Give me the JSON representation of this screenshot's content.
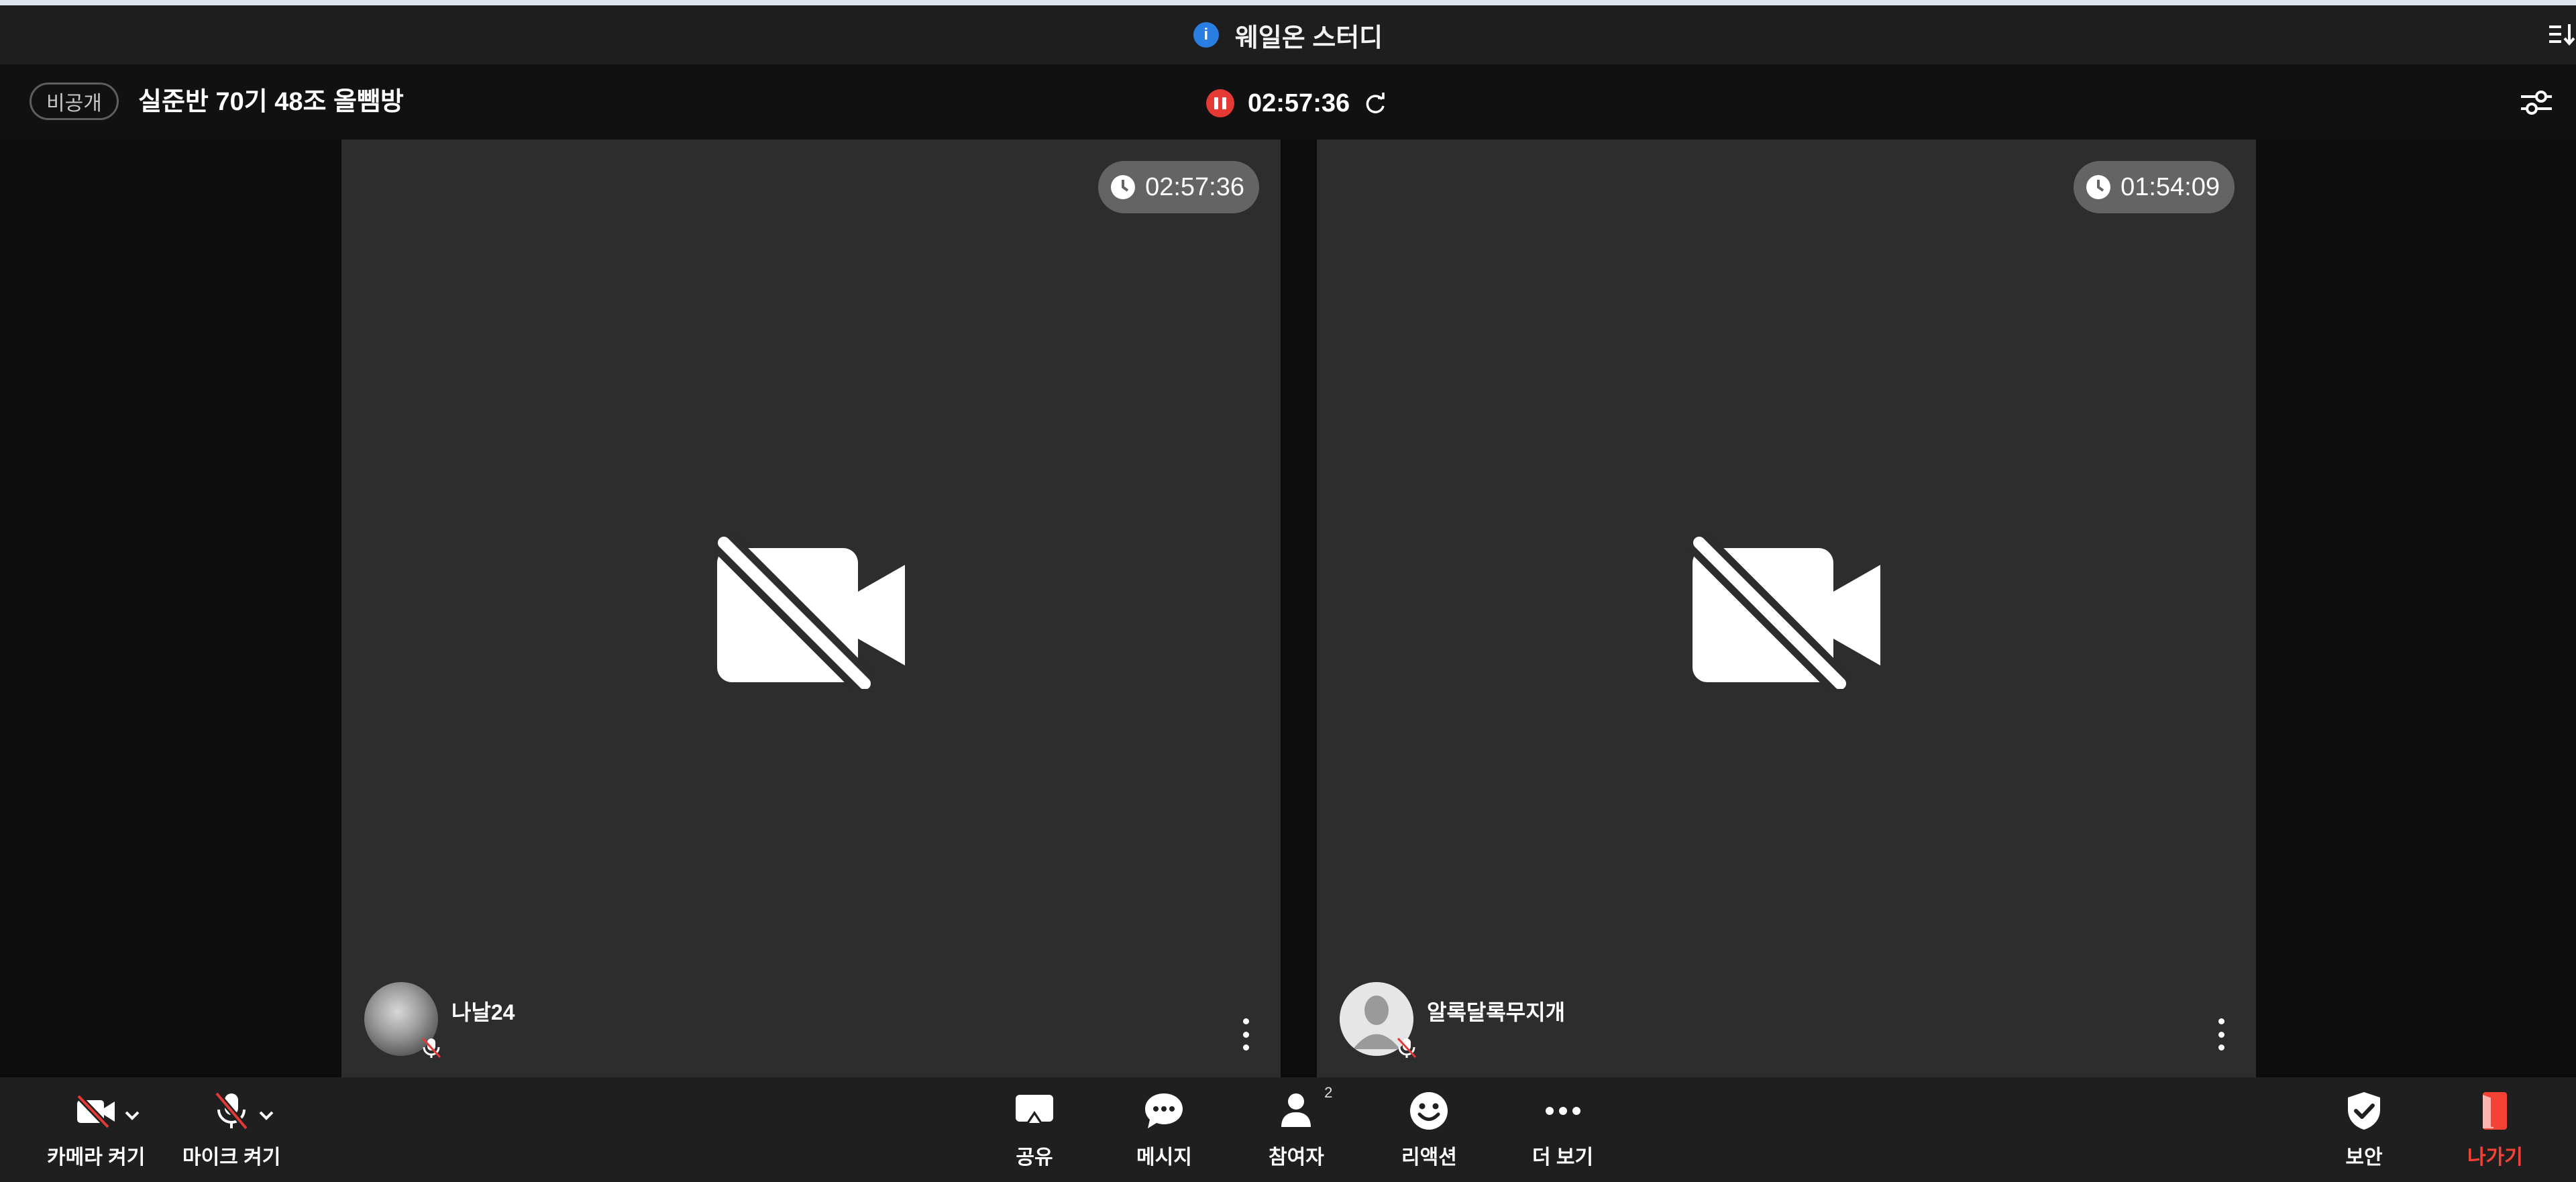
{
  "window": {
    "title": "웨일온 스터디"
  },
  "meeting": {
    "visibility_badge": "비공개",
    "title": "실준반 70기 48조 올뺌방",
    "recording_time": "02:57:36"
  },
  "participants": [
    {
      "name": "나날24",
      "duration": "02:57:36",
      "avatar": "photo",
      "camera": "off",
      "mic": "off"
    },
    {
      "name": "알록달록무지개",
      "duration": "01:54:09",
      "avatar": "default",
      "camera": "off",
      "mic": "off"
    }
  ],
  "toolbar": {
    "camera_label": "카메라 켜기",
    "mic_label": "마이크 켜기",
    "share_label": "공유",
    "message_label": "메시지",
    "participants_label": "참여자",
    "participants_count": "2",
    "reaction_label": "리액션",
    "more_label": "더 보기",
    "security_label": "보안",
    "exit_label": "나가기"
  },
  "colors": {
    "info_blue": "#2a7de1",
    "record_red": "#e53935",
    "exit_red": "#f44336"
  },
  "icons": [
    "info-icon",
    "sort-menu-icon",
    "pause-icon",
    "refresh-icon",
    "settings-sliders-icon",
    "clock-icon",
    "camera-off-icon",
    "mic-off-icon",
    "chevron-down-icon",
    "share-icon",
    "chat-icon",
    "person-icon",
    "smile-icon",
    "more-dots-icon",
    "shield-check-icon",
    "exit-door-icon",
    "kebab-menu-icon"
  ]
}
